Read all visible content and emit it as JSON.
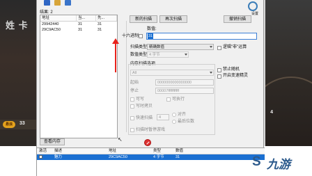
{
  "game": {
    "hud_text": "姓 卡",
    "badge": "悬浪",
    "count_left": "33",
    "count_right": "4"
  },
  "toolbar": {
    "icons": [
      "computer-icon",
      "open-icon",
      "save-icon"
    ],
    "colors": {
      "computer": "#2f66c4",
      "open": "#d7a53a",
      "save": "#3a74c9"
    }
  },
  "found_label": "结果: 2",
  "results": {
    "headers": [
      "地址",
      "当...",
      "先..."
    ],
    "rows": [
      [
        "29942440",
        "31",
        "31"
      ],
      [
        "29C9AC50",
        "31",
        "31"
      ]
    ]
  },
  "scan": {
    "first_scan": "新的扫描",
    "next_scan": "再次扫描",
    "undo_scan": "撤销扫描",
    "value_label": "数值:",
    "hex_label": "十六进制",
    "value": "31",
    "scan_type_label": "扫描类型",
    "scan_type_value": "精确数值",
    "value_type_label": "数值类型",
    "value_type_value": "4 字节",
    "memory_options_label": "内存扫描选项",
    "memory_region_value": "All",
    "start_label": "起始",
    "start_value": "0000000000000000",
    "stop_label": "停止",
    "stop_value": "00007fffffffffff",
    "writable_label": "可写",
    "executable_label": "可执行",
    "copy_on_write_label": "写时拷贝",
    "fast_scan_label": "快速扫描",
    "fast_scan_value": "4",
    "alignment_label": "对齐",
    "last_digits_label": "最后位数",
    "pause_label": "扫描时暂停游戏",
    "lua_label": "逻辑\"非\"运算",
    "no_random_label": "禁止随机",
    "speedhack_label": "开启变速精灵"
  },
  "logo": {
    "label": "设置",
    "color": "#3b7db8"
  },
  "view_memory": "查看内存",
  "address_list": {
    "headers": [
      "激活",
      "描述",
      "地址",
      "类型",
      "数值"
    ],
    "rows": [
      [
        "",
        "魅力",
        "29C9AC50",
        "4 字节",
        "31"
      ]
    ],
    "selected_color": "#1a6fd1"
  },
  "watermark": {
    "text": "九游",
    "color": "#2c5a8c"
  }
}
